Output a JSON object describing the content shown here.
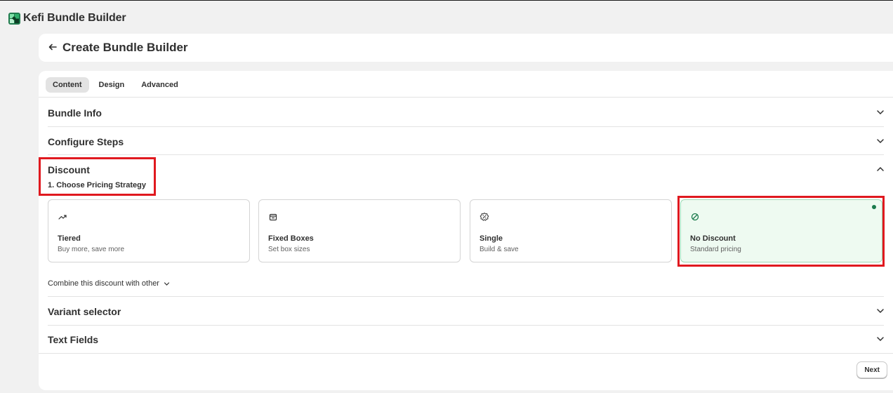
{
  "app": {
    "title": "Kefi Bundle Builder",
    "logo_icon": "kefi-logo-icon"
  },
  "header": {
    "back_icon": "arrow-left-icon",
    "title": "Create Bundle Builder"
  },
  "tabs": [
    {
      "label": "Content",
      "active": true
    },
    {
      "label": "Design",
      "active": false
    },
    {
      "label": "Advanced",
      "active": false
    }
  ],
  "sections": {
    "bundle_info": "Bundle Info",
    "configure_steps": "Configure Steps",
    "discount": "Discount",
    "variant_selector": "Variant selector",
    "text_fields": "Text Fields"
  },
  "discount": {
    "step_heading": "1. Choose Pricing Strategy",
    "options": [
      {
        "title": "Tiered",
        "desc": "Buy more, save more",
        "icon": "trend-up-icon",
        "selected": false
      },
      {
        "title": "Fixed Boxes",
        "desc": "Set box sizes",
        "icon": "box-icon",
        "selected": false
      },
      {
        "title": "Single",
        "desc": "Build & save",
        "icon": "discount-badge-icon",
        "selected": false
      },
      {
        "title": "No Discount",
        "desc": "Standard pricing",
        "icon": "no-entry-icon",
        "selected": true
      }
    ],
    "combine_label": "Combine this discount with other"
  },
  "footer": {
    "next_label": "Next"
  },
  "colors": {
    "selected_bg": "#eefaf1",
    "selected_dot": "#1a7a4c",
    "highlight": "#e0191f",
    "page_bg": "#f1f1f1"
  }
}
